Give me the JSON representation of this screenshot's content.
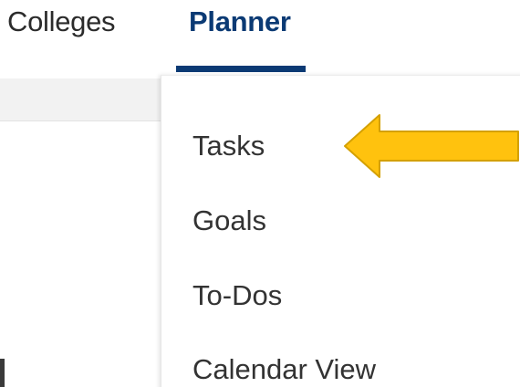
{
  "nav": {
    "tabs": [
      {
        "label": "Colleges",
        "active": false
      },
      {
        "label": "Planner",
        "active": true
      }
    ],
    "active_color": "#0b3a74"
  },
  "dropdown": {
    "items": [
      {
        "label": "Tasks"
      },
      {
        "label": "Goals"
      },
      {
        "label": "To-Dos"
      },
      {
        "label": "Calendar View"
      }
    ]
  },
  "annotation": {
    "arrow_icon": "left-arrow-icon",
    "arrow_color": "#ffc20e",
    "arrow_outline": "#d4a000"
  }
}
